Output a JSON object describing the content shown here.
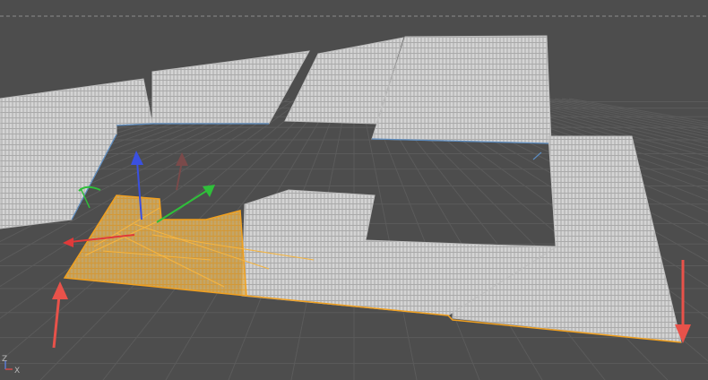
{
  "viewport": {
    "background": "#4d4d4d",
    "grid_color": "#5b5b5b",
    "safe_frame_color": "#8a8a8a",
    "camera": "perspective"
  },
  "colors": {
    "mesh_fill": "#cfcfcf",
    "mesh_wire": "#a9a9a9",
    "mesh_edge_highlight": "#5b8bbf",
    "selection_fill": "#d9b46a",
    "selection_wire": "#f0a020",
    "arrow_red": "#e8524a",
    "axis_x": "#e03a3a",
    "axis_y": "#2fbf3a",
    "axis_z": "#3a50e0"
  },
  "objects": [
    {
      "name": "floor-tile-panel-group",
      "material": "tile-pattern",
      "selected": false
    },
    {
      "name": "selected-floor-section",
      "material": "tile-pattern",
      "selected": true
    }
  ],
  "axis_indicator": {
    "x_label": "X",
    "z_label": "Z",
    "icons": [
      "x-axis-icon",
      "z-axis-icon"
    ]
  },
  "annotations": {
    "left_arrow": "up-arrow-icon",
    "right_arrow": "down-arrow-icon"
  }
}
